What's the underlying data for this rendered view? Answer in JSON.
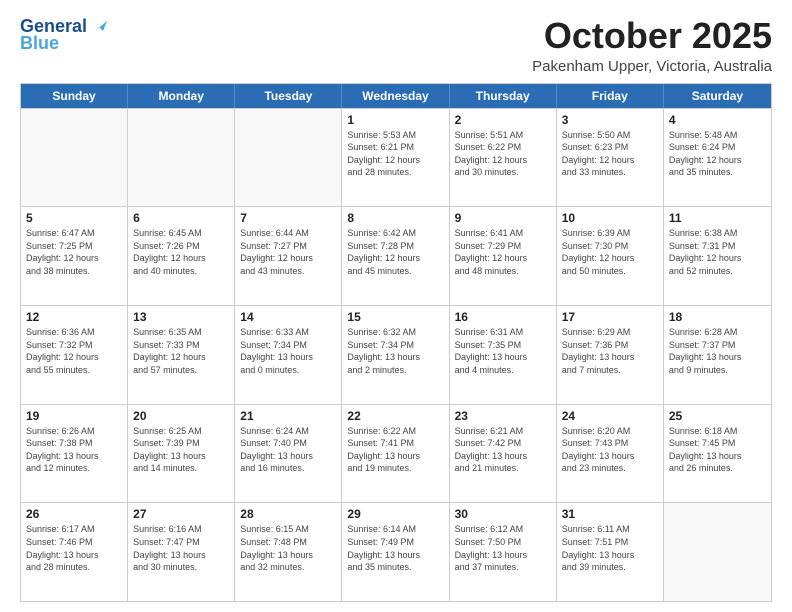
{
  "header": {
    "logo_line1": "General",
    "logo_line2": "Blue",
    "month": "October 2025",
    "location": "Pakenham Upper, Victoria, Australia"
  },
  "weekdays": [
    "Sunday",
    "Monday",
    "Tuesday",
    "Wednesday",
    "Thursday",
    "Friday",
    "Saturday"
  ],
  "rows": [
    [
      {
        "day": "",
        "info": ""
      },
      {
        "day": "",
        "info": ""
      },
      {
        "day": "",
        "info": ""
      },
      {
        "day": "1",
        "info": "Sunrise: 5:53 AM\nSunset: 6:21 PM\nDaylight: 12 hours\nand 28 minutes."
      },
      {
        "day": "2",
        "info": "Sunrise: 5:51 AM\nSunset: 6:22 PM\nDaylight: 12 hours\nand 30 minutes."
      },
      {
        "day": "3",
        "info": "Sunrise: 5:50 AM\nSunset: 6:23 PM\nDaylight: 12 hours\nand 33 minutes."
      },
      {
        "day": "4",
        "info": "Sunrise: 5:48 AM\nSunset: 6:24 PM\nDaylight: 12 hours\nand 35 minutes."
      }
    ],
    [
      {
        "day": "5",
        "info": "Sunrise: 6:47 AM\nSunset: 7:25 PM\nDaylight: 12 hours\nand 38 minutes."
      },
      {
        "day": "6",
        "info": "Sunrise: 6:45 AM\nSunset: 7:26 PM\nDaylight: 12 hours\nand 40 minutes."
      },
      {
        "day": "7",
        "info": "Sunrise: 6:44 AM\nSunset: 7:27 PM\nDaylight: 12 hours\nand 43 minutes."
      },
      {
        "day": "8",
        "info": "Sunrise: 6:42 AM\nSunset: 7:28 PM\nDaylight: 12 hours\nand 45 minutes."
      },
      {
        "day": "9",
        "info": "Sunrise: 6:41 AM\nSunset: 7:29 PM\nDaylight: 12 hours\nand 48 minutes."
      },
      {
        "day": "10",
        "info": "Sunrise: 6:39 AM\nSunset: 7:30 PM\nDaylight: 12 hours\nand 50 minutes."
      },
      {
        "day": "11",
        "info": "Sunrise: 6:38 AM\nSunset: 7:31 PM\nDaylight: 12 hours\nand 52 minutes."
      }
    ],
    [
      {
        "day": "12",
        "info": "Sunrise: 6:36 AM\nSunset: 7:32 PM\nDaylight: 12 hours\nand 55 minutes."
      },
      {
        "day": "13",
        "info": "Sunrise: 6:35 AM\nSunset: 7:33 PM\nDaylight: 12 hours\nand 57 minutes."
      },
      {
        "day": "14",
        "info": "Sunrise: 6:33 AM\nSunset: 7:34 PM\nDaylight: 13 hours\nand 0 minutes."
      },
      {
        "day": "15",
        "info": "Sunrise: 6:32 AM\nSunset: 7:34 PM\nDaylight: 13 hours\nand 2 minutes."
      },
      {
        "day": "16",
        "info": "Sunrise: 6:31 AM\nSunset: 7:35 PM\nDaylight: 13 hours\nand 4 minutes."
      },
      {
        "day": "17",
        "info": "Sunrise: 6:29 AM\nSunset: 7:36 PM\nDaylight: 13 hours\nand 7 minutes."
      },
      {
        "day": "18",
        "info": "Sunrise: 6:28 AM\nSunset: 7:37 PM\nDaylight: 13 hours\nand 9 minutes."
      }
    ],
    [
      {
        "day": "19",
        "info": "Sunrise: 6:26 AM\nSunset: 7:38 PM\nDaylight: 13 hours\nand 12 minutes."
      },
      {
        "day": "20",
        "info": "Sunrise: 6:25 AM\nSunset: 7:39 PM\nDaylight: 13 hours\nand 14 minutes."
      },
      {
        "day": "21",
        "info": "Sunrise: 6:24 AM\nSunset: 7:40 PM\nDaylight: 13 hours\nand 16 minutes."
      },
      {
        "day": "22",
        "info": "Sunrise: 6:22 AM\nSunset: 7:41 PM\nDaylight: 13 hours\nand 19 minutes."
      },
      {
        "day": "23",
        "info": "Sunrise: 6:21 AM\nSunset: 7:42 PM\nDaylight: 13 hours\nand 21 minutes."
      },
      {
        "day": "24",
        "info": "Sunrise: 6:20 AM\nSunset: 7:43 PM\nDaylight: 13 hours\nand 23 minutes."
      },
      {
        "day": "25",
        "info": "Sunrise: 6:18 AM\nSunset: 7:45 PM\nDaylight: 13 hours\nand 26 minutes."
      }
    ],
    [
      {
        "day": "26",
        "info": "Sunrise: 6:17 AM\nSunset: 7:46 PM\nDaylight: 13 hours\nand 28 minutes."
      },
      {
        "day": "27",
        "info": "Sunrise: 6:16 AM\nSunset: 7:47 PM\nDaylight: 13 hours\nand 30 minutes."
      },
      {
        "day": "28",
        "info": "Sunrise: 6:15 AM\nSunset: 7:48 PM\nDaylight: 13 hours\nand 32 minutes."
      },
      {
        "day": "29",
        "info": "Sunrise: 6:14 AM\nSunset: 7:49 PM\nDaylight: 13 hours\nand 35 minutes."
      },
      {
        "day": "30",
        "info": "Sunrise: 6:12 AM\nSunset: 7:50 PM\nDaylight: 13 hours\nand 37 minutes."
      },
      {
        "day": "31",
        "info": "Sunrise: 6:11 AM\nSunset: 7:51 PM\nDaylight: 13 hours\nand 39 minutes."
      },
      {
        "day": "",
        "info": ""
      }
    ]
  ]
}
